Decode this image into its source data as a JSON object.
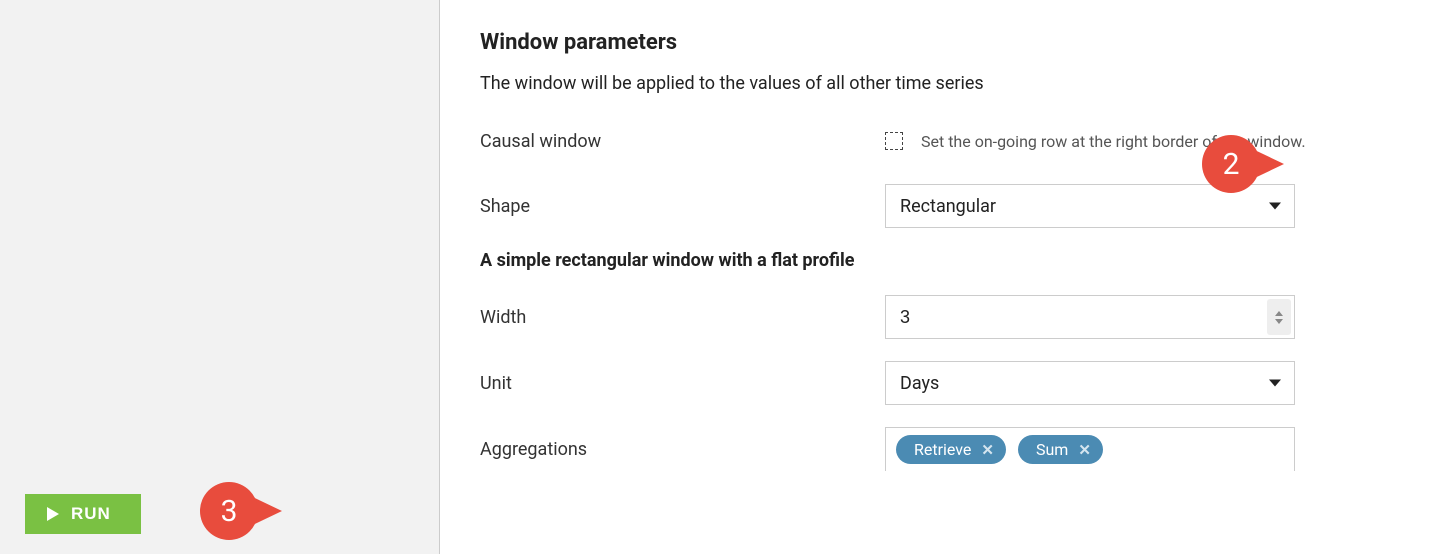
{
  "sidebar": {
    "run_label": "RUN"
  },
  "section": {
    "title": "Window parameters",
    "description": "The window will be applied to the values of all other time series"
  },
  "causal": {
    "label": "Causal window",
    "help": "Set the on-going row at the right border of the window."
  },
  "shape": {
    "label": "Shape",
    "value": "Rectangular"
  },
  "subsection": "A simple rectangular window with a flat profile",
  "width": {
    "label": "Width",
    "value": "3"
  },
  "unit": {
    "label": "Unit",
    "value": "Days"
  },
  "aggregations": {
    "label": "Aggregations",
    "tag1": "Retrieve",
    "tag2": "Sum"
  },
  "annotations": {
    "step2": "2",
    "step3": "3"
  }
}
